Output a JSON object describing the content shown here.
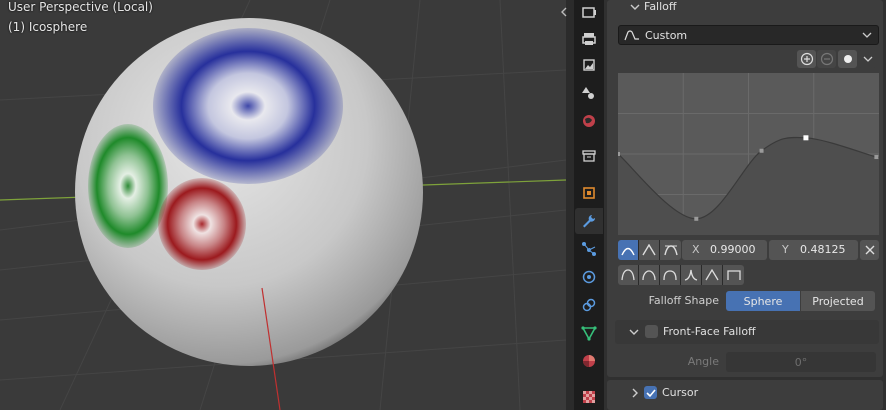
{
  "viewport": {
    "title": "User Perspective (Local)",
    "object_label": "(1) Icosphere"
  },
  "tabs": [
    {
      "icon": "render-icon"
    },
    {
      "icon": "output-icon"
    },
    {
      "icon": "view-layer-icon"
    },
    {
      "icon": "scene-icon"
    },
    {
      "icon": "world-icon"
    },
    {
      "icon": "collection-icon"
    },
    {
      "icon": "object-icon"
    },
    {
      "icon": "modifier-wrench-icon"
    },
    {
      "icon": "particles-icon"
    },
    {
      "icon": "physics-icon"
    },
    {
      "icon": "constraints-icon"
    },
    {
      "icon": "object-data-icon"
    },
    {
      "icon": "material-icon"
    },
    {
      "icon": "texture-icon"
    }
  ],
  "falloff": {
    "header": "Falloff",
    "preset": "Custom",
    "x_label": "X",
    "x_value": "0.99000",
    "y_label": "Y",
    "y_value": "0.48125",
    "shape_label": "Falloff Shape",
    "shape_options": [
      "Sphere",
      "Projected"
    ],
    "shape_selected": "Sphere",
    "front_face": {
      "label": "Front-Face Falloff",
      "checked": false,
      "angle_label": "Angle",
      "angle_value": "0°"
    }
  },
  "cursor": {
    "label": "Cursor",
    "checked": true
  },
  "curve": {
    "points": [
      [
        0.0,
        0.5
      ],
      [
        0.3,
        0.1
      ],
      [
        0.55,
        0.52
      ],
      [
        0.72,
        0.6
      ],
      [
        0.99,
        0.48125
      ]
    ]
  },
  "colors": {
    "accent": "#4772b3",
    "panel": "#3d3d3d",
    "sphere": "#c9c9c9"
  }
}
